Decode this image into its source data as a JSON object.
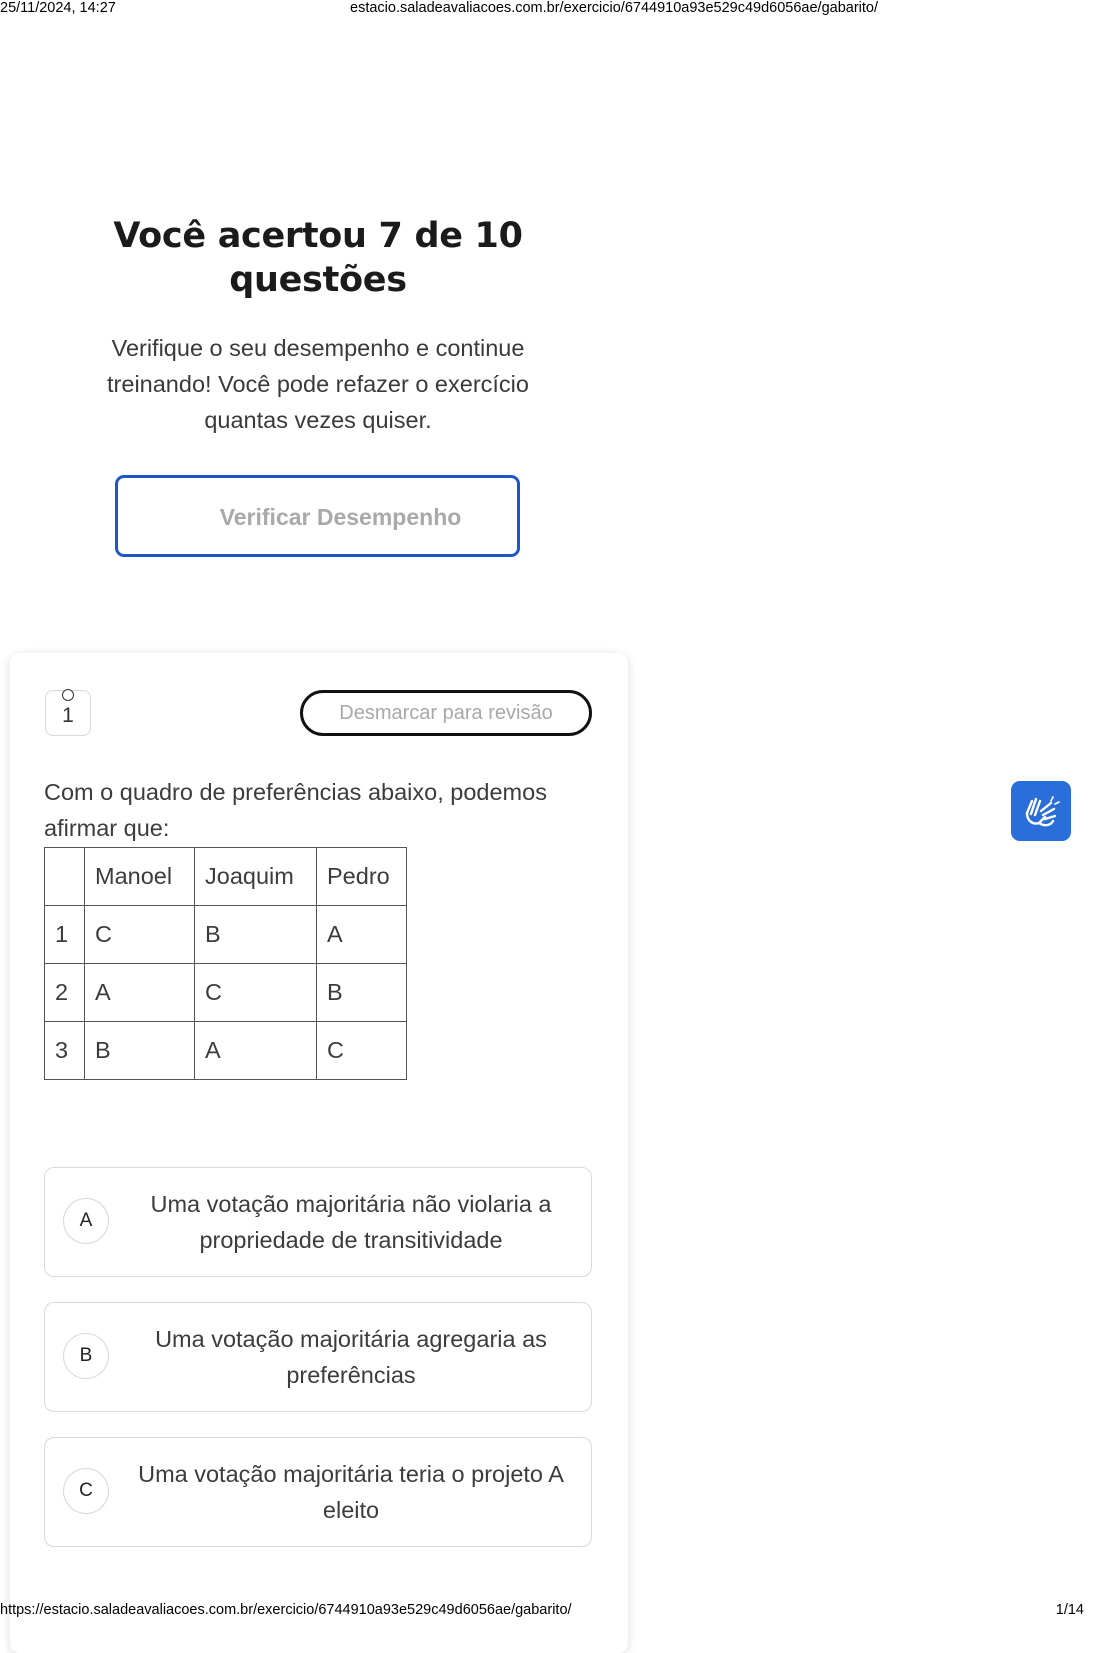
{
  "print_header": {
    "datetime": "25/11/2024, 14:27",
    "url": "estacio.saladeavaliacoes.com.br/exercicio/6744910a93e529c49d6056ae/gabarito/"
  },
  "result": {
    "title": "Você acertou 7 de 10 questões",
    "subtitle": "Verifique o seu desempenho e continue treinando! Você pode refazer o exercício quantas vezes quiser.",
    "verify_button": "Verificar Desempenho"
  },
  "question": {
    "number": "1",
    "review_button": "Desmarcar para revisão",
    "text": "Com o quadro de preferências abaixo, podemos afirmar que:",
    "table": {
      "headers": [
        "",
        "Manoel",
        "Joaquim",
        "Pedro"
      ],
      "rows": [
        [
          "1",
          "C",
          "B",
          "A"
        ],
        [
          "2",
          "A",
          "C",
          "B"
        ],
        [
          "3",
          "B",
          "A",
          "C"
        ]
      ]
    },
    "options": [
      {
        "letter": "A",
        "text": "Uma votação majoritária não violaria a propriedade de transitividade"
      },
      {
        "letter": "B",
        "text": "Uma votação majoritária agregaria as preferências"
      },
      {
        "letter": "C",
        "text": "Uma votação majoritária teria o projeto A eleito"
      }
    ]
  },
  "accessibility": {
    "libras_icon": "sign-language-icon",
    "color": "#2a6fd9"
  },
  "print_footer": {
    "url": "https://estacio.saladeavaliacoes.com.br/exercicio/6744910a93e529c49d6056ae/gabarito/",
    "page": "1/14"
  }
}
